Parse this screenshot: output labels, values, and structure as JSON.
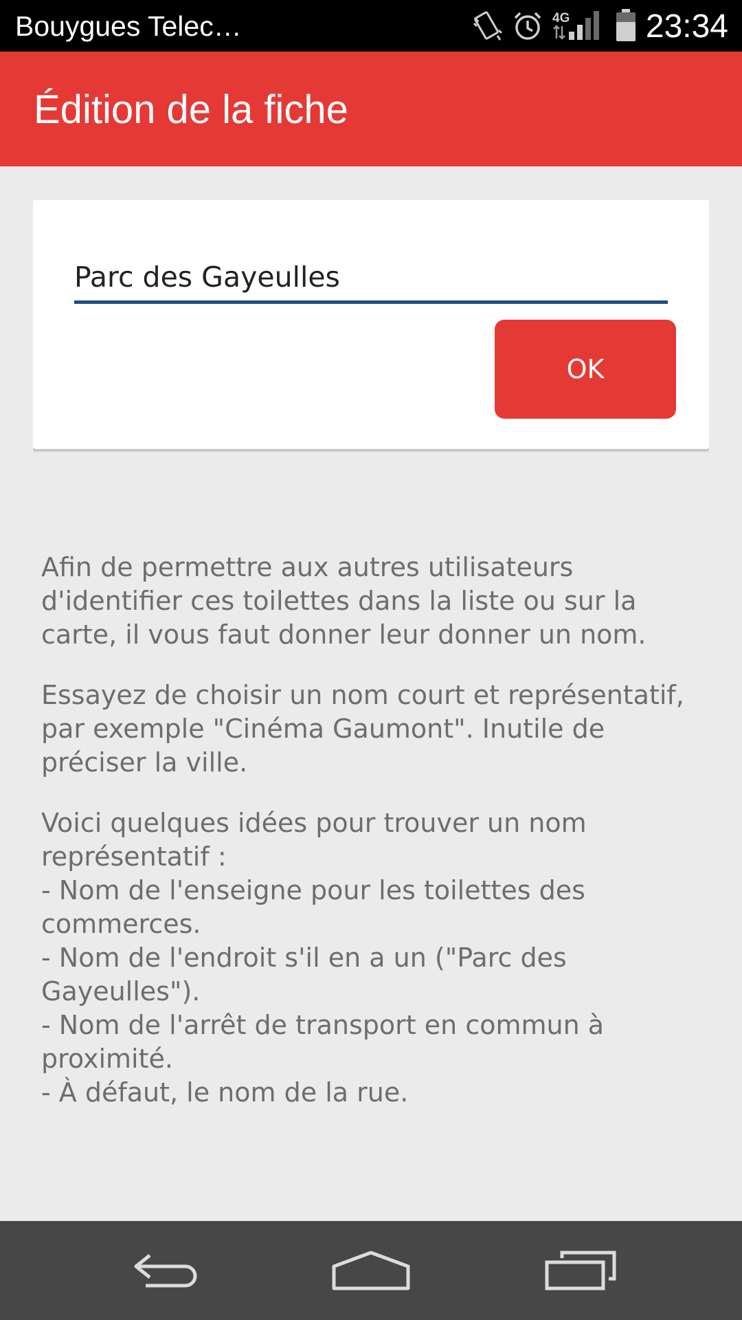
{
  "status_bar": {
    "carrier": "Bouygues Telec…",
    "network": "4G",
    "time": "23:34"
  },
  "app_bar": {
    "title": "Édition de la fiche"
  },
  "form": {
    "name_value": "Parc des Gayeulles",
    "ok_label": "OK"
  },
  "help": {
    "paragraph_1": "Afin de permettre aux autres utilisateurs d'identifier ces toilettes dans la liste ou sur la carte, il vous faut donner leur donner un nom.",
    "paragraph_2": "Essayez de choisir un nom court et représentatif, par exemple \"Cinéma Gaumont\". Inutile de préciser la ville.",
    "tips_intro": "Voici quelques idées pour trouver un nom représentatif :",
    "tips": [
      " - Nom de l'enseigne pour les toilettes des commerces.",
      " - Nom de l'endroit s'il en a un (\"Parc des Gayeulles\").",
      " - Nom de l'arrêt de transport en commun à proximité.",
      " - À défaut, le nom de la rue."
    ]
  },
  "colors": {
    "accent": "#e53935",
    "input_underline": "#1e4f85",
    "background": "#ebebeb",
    "nav_bar": "#474747"
  },
  "icons": {
    "status": [
      "vibrate-icon",
      "alarm-icon",
      "signal-4g-icon",
      "battery-icon"
    ],
    "nav": [
      "back-icon",
      "home-icon",
      "recent-apps-icon"
    ]
  }
}
